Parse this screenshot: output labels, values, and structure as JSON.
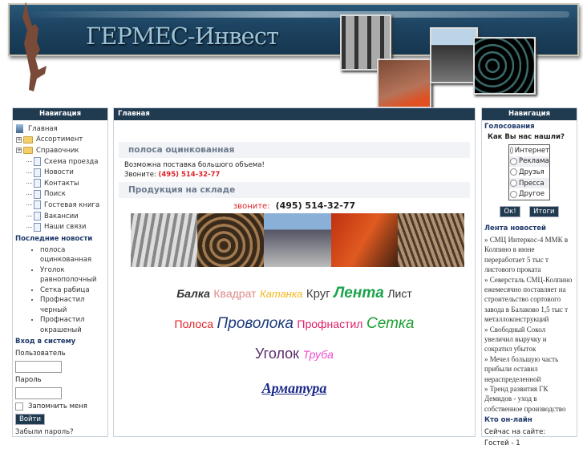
{
  "header": {
    "logo_text": "ГЕРМЕС-Инвест"
  },
  "left": {
    "title": "Навигация",
    "tree": [
      {
        "label": "Главная",
        "icon": "computer-icon"
      },
      {
        "label": "Ассортимент",
        "icon": "folder-icon",
        "expand": true
      },
      {
        "label": "Справочник",
        "icon": "folder-icon",
        "expand": true
      },
      {
        "label": "Схема проезда",
        "icon": "document-icon"
      },
      {
        "label": "Новости",
        "icon": "document-icon"
      },
      {
        "label": "Контакты",
        "icon": "document-icon"
      },
      {
        "label": "Поиск",
        "icon": "document-icon"
      },
      {
        "label": "Гостевая книга",
        "icon": "document-icon"
      },
      {
        "label": "Вакансии",
        "icon": "document-icon"
      },
      {
        "label": "Наши связи",
        "icon": "document-icon"
      }
    ],
    "news_title": "Последние новости",
    "news": [
      "полоса оцинкованная",
      "Уголок равнополочный",
      "Сетка рабица",
      "Профнастил черный",
      "Профнастил окрашеный"
    ],
    "login_title": "Вход в систему",
    "user_label": "Пользователь",
    "pass_label": "Пароль",
    "remember_label": "Запомнить меня",
    "login_button": "Войти",
    "forgot_link": "Забыли пароль?"
  },
  "center": {
    "title": "Главная",
    "news_heading": "полоса оцинкованная",
    "news_text": "Возможна поставка большого объема!",
    "call_label": "Звоните:",
    "phone": "(495) 514-32-77",
    "stock_heading": "Продукция на складе",
    "call_label2": "звоните:",
    "phone2": "(495) 514-32-77",
    "cloud": [
      [
        {
          "t": "Балка",
          "c": "#333333",
          "s": 14,
          "i": true,
          "b": true
        },
        {
          "t": "Квадрат",
          "c": "#e08a8a",
          "s": 14
        },
        {
          "t": "Катанка",
          "c": "#f2b81c",
          "s": 13,
          "i": true
        },
        {
          "t": "Круг",
          "c": "#444444",
          "s": 15
        },
        {
          "t": "Лента",
          "c": "#1aa44a",
          "s": 19,
          "i": true,
          "b": true
        },
        {
          "t": "Лист",
          "c": "#333333",
          "s": 14
        }
      ],
      [
        {
          "t": "Полоса",
          "c": "#e0242a",
          "s": 14
        },
        {
          "t": "Проволока",
          "c": "#1a3a7a",
          "s": 19,
          "i": true
        },
        {
          "t": "Профнастил",
          "c": "#e0206a",
          "s": 14
        },
        {
          "t": "Сетка",
          "c": "#1aa030",
          "s": 19,
          "i": true
        }
      ],
      [
        {
          "t": "Уголок",
          "c": "#5a2a6a",
          "s": 18
        },
        {
          "t": "Труба",
          "c": "#f04ad0",
          "s": 14,
          "i": true
        }
      ],
      [
        {
          "t": "Арматура",
          "c": "#1a2a8a",
          "s": 18,
          "i": true,
          "b": true,
          "serif": true,
          "u": true
        }
      ]
    ]
  },
  "right": {
    "title": "Навигация",
    "poll_title": "Голосования",
    "poll_question": "Как Вы нас нашли?",
    "poll_options": [
      "Интернет",
      "Реклама",
      "Друзья",
      "Пресса",
      "Другое"
    ],
    "ok_button": "Ок!",
    "results_button": "Итоги",
    "feed_title": "Лента новостей",
    "feed": [
      "» СМЦ Интеркос-4 ММК в Колпино в июне переработает 5 тыс т листового проката",
      "» Северсталь СМЦ-Колпино ежемесячно поставляет на строительство сортового завода в Балаково 1,5 тыс т металлоконструкций",
      "» Свободный Сокол увеличил выручку и сократил убыток",
      "» Мечел большую часть прибыли оставил нераспределенной",
      "» Тренд развития ГК Демидов - уход в собственное производство"
    ],
    "online_title": "Кто он-лайн",
    "online_now": "Сейчас на сайте:",
    "guests": "Гостей - 1"
  }
}
